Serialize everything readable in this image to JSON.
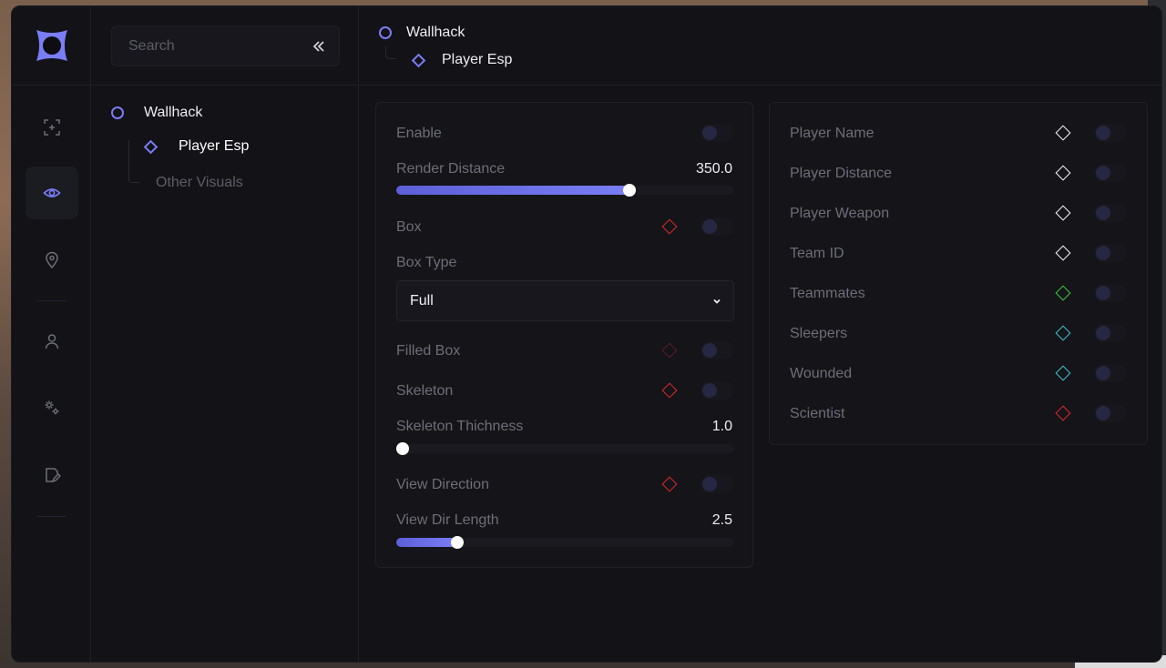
{
  "search": {
    "placeholder": "Search"
  },
  "tree": {
    "root": "Wallhack",
    "child": "Player Esp",
    "other": "Other Visuals"
  },
  "breadcrumb": {
    "root": "Wallhack",
    "child": "Player Esp"
  },
  "left_panel": {
    "enable": "Enable",
    "render_distance": {
      "label": "Render Distance",
      "value": "350.0",
      "fraction": 0.69
    },
    "box": "Box",
    "box_type": {
      "label": "Box Type",
      "selected": "Full"
    },
    "filled_box": "Filled Box",
    "skeleton": "Skeleton",
    "skeleton_thickness": {
      "label": "Skeleton Thichness",
      "value": "1.0",
      "fraction": 0.0
    },
    "view_direction": "View Direction",
    "view_dir_length": {
      "label": "View Dir Length",
      "value": "2.5",
      "fraction": 0.18
    }
  },
  "right_panel": {
    "items": [
      {
        "label": "Player Name",
        "color": "#ffffff"
      },
      {
        "label": "Player Distance",
        "color": "#ffffff"
      },
      {
        "label": "Player Weapon",
        "color": "#ffffff"
      },
      {
        "label": "Team ID",
        "color": "#ffffff"
      },
      {
        "label": "Teammates",
        "color": "#3ecf3e"
      },
      {
        "label": "Sleepers",
        "color": "#3ec9d4"
      },
      {
        "label": "Wounded",
        "color": "#3ec9d4"
      },
      {
        "label": "Scientist",
        "color": "#e02a2a"
      }
    ]
  },
  "colors": {
    "accent": "#7a7ef5",
    "box_diamond": "#e02a2a",
    "filled_box_diamond": "#5a1f22",
    "skeleton_diamond": "#e02a2a",
    "view_direction_diamond": "#e02a2a"
  },
  "rail": {
    "icons": [
      "app-logo-icon",
      "crosshair-icon",
      "eye-icon",
      "location-pin-icon",
      "user-icon",
      "gears-icon",
      "edit-document-icon"
    ],
    "active": "eye-icon"
  }
}
